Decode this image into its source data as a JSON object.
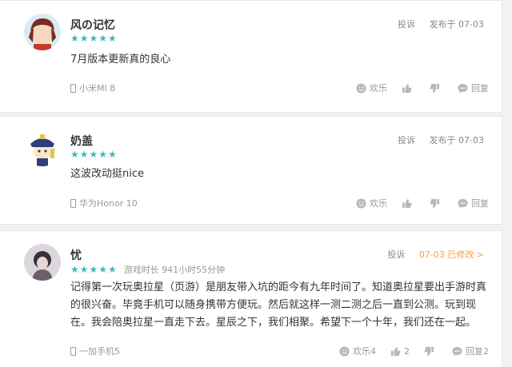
{
  "reviews": [
    {
      "username": "风の记忆",
      "stars": "★★★★★",
      "playtime": "",
      "report": "投诉",
      "date": "发布于 07-03",
      "comment": "7月版本更新真的良心",
      "device": "小米MI 8",
      "joy": "欢乐",
      "like": "",
      "dislike": "",
      "reply": "回复"
    },
    {
      "username": "奶盖",
      "stars": "★★★★★",
      "playtime": "",
      "report": "投诉",
      "date": "发布于 07-03",
      "comment": "这波改动挺nice",
      "device": "华为Honor 10",
      "joy": "欢乐",
      "like": "",
      "dislike": "",
      "reply": "回复"
    },
    {
      "username": "忧",
      "stars": "★★★★★",
      "playtime": "游戏时长 941小时55分钟",
      "report": "投诉",
      "date": "07-03 已修改 >",
      "comment": "记得第一次玩奥拉星（页游）是朋友带入坑的距今有九年时间了。知道奥拉星要出手游时真的很兴奋。毕竟手机可以随身携带方便玩。然后就这样一测二测之后一直到公测。玩到现在。我会陪奥拉星一直走下去。星辰之下，我们相聚。希望下一个十年，我们还在一起。",
      "device": "一加手机5",
      "joy": "欢乐4",
      "like": "2",
      "dislike": "",
      "reply": "回复2"
    }
  ],
  "colors": {
    "accent": "#3fb8bd",
    "edited": "#f6a23c",
    "muted": "#999999"
  },
  "icons": [
    "phone-icon",
    "smile-icon",
    "thumbs-up-icon",
    "thumbs-down-icon",
    "comment-icon"
  ]
}
